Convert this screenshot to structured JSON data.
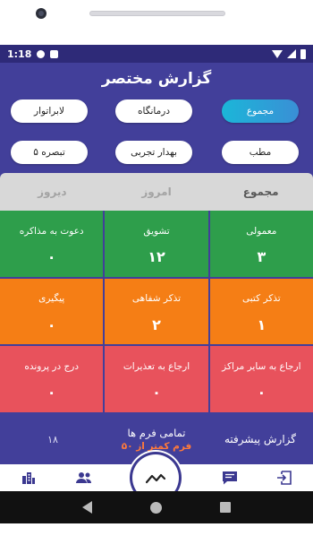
{
  "status_bar": {
    "time": "1:18"
  },
  "title": "گزارش مختصر",
  "filters": [
    {
      "label": "مجموع",
      "active": true
    },
    {
      "label": "درمانگاه",
      "active": false
    },
    {
      "label": "لابراتوار",
      "active": false
    },
    {
      "label": "مطب",
      "active": false
    },
    {
      "label": "بهدار تجربی",
      "active": false
    },
    {
      "label": "تبصره ۵",
      "active": false
    }
  ],
  "tabs": [
    {
      "label": "مجموع",
      "active": true
    },
    {
      "label": "امروز",
      "active": false
    },
    {
      "label": "دیروز",
      "active": false
    }
  ],
  "cells": [
    {
      "label": "معمولی",
      "value": "۳",
      "color": "#2e9e4b"
    },
    {
      "label": "تشویق",
      "value": "۱۲",
      "color": "#2e9e4b"
    },
    {
      "label": "دعوت به مذاکره",
      "value": "۰",
      "color": "#2e9e4b"
    },
    {
      "label": "تذکر کتبی",
      "value": "۱",
      "color": "#f57e15"
    },
    {
      "label": "تذکر شفاهی",
      "value": "۲",
      "color": "#f57e15"
    },
    {
      "label": "پیگیری",
      "value": "۰",
      "color": "#f57e15"
    },
    {
      "label": "ارجاع به سایر مراکز",
      "value": "۰",
      "color": "#e8525c"
    },
    {
      "label": "ارجاع به تعذیرات",
      "value": "۰",
      "color": "#e8525c"
    },
    {
      "label": "درج در پرونده",
      "value": "۰",
      "color": "#e8525c"
    }
  ],
  "summary": {
    "report_label": "گزارش پیشرفته",
    "forms_label": "تمامی فرم ها",
    "forms_sub": "فرم کمتر از ۵۰",
    "count": "۱۸"
  },
  "bottom_nav": {
    "items": [
      "exit-icon",
      "chat-icon",
      "chart-line-icon",
      "users-icon",
      "buildings-icon"
    ]
  },
  "colors": {
    "primary": "#423f9a",
    "status_bar": "#2e2a78",
    "green": "#2e9e4b",
    "orange": "#f57e15",
    "red": "#e8525c",
    "accent_text": "#ff7a3a"
  }
}
